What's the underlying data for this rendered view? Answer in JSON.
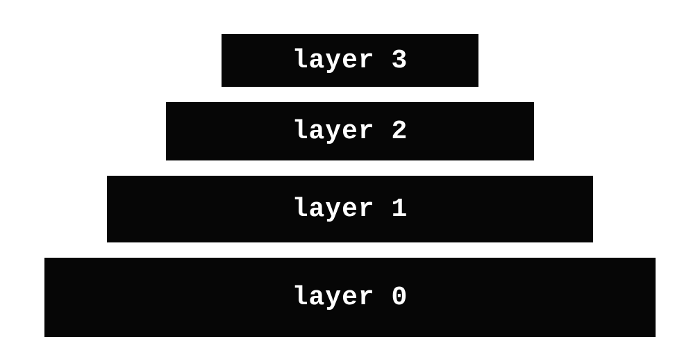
{
  "layers": [
    {
      "label": "layer 3"
    },
    {
      "label": "layer 2"
    },
    {
      "label": "layer 1"
    },
    {
      "label": "layer 0"
    }
  ],
  "colors": {
    "background": "#ffffff",
    "layer_bg": "#060606",
    "layer_text": "#ffffff"
  }
}
